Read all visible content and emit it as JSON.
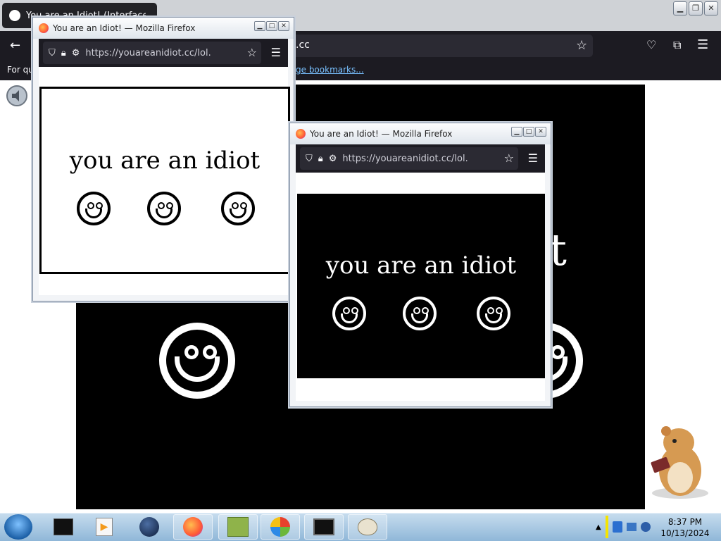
{
  "main_window": {
    "tab_title": "You are an Idiot! (Interface)",
    "url_fragment": ".cc",
    "bookmark_left": "For qu",
    "bookmark_link": "ge bookmarks...",
    "page_fragment": "t"
  },
  "popups": [
    {
      "title": "You are an Idiot! — Mozilla Firefox",
      "url": "https://youareanidiot.cc/lol.",
      "headline": "you are an idiot",
      "theme": "light"
    },
    {
      "title": "You are an Idiot! — Mozilla Firefox",
      "url": "https://youareanidiot.cc/lol.",
      "headline": "you are an idiot",
      "theme": "dark"
    }
  ],
  "taskbar": {
    "time": "8:37 PM",
    "date": "10/13/2024"
  },
  "colors": {
    "firefox_toolbar": "#1c1b22",
    "urlbar": "#2b2a33",
    "page_black": "#000000",
    "link": "#79c1ff"
  }
}
